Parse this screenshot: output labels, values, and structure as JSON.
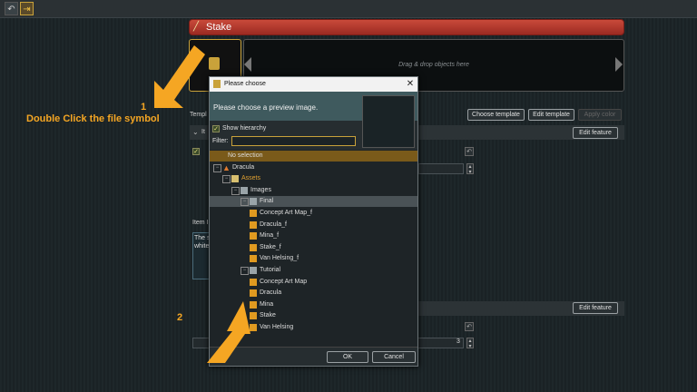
{
  "topbar": {
    "btn1_icon": "undo-icon",
    "btn2_icon": "export-icon"
  },
  "editor": {
    "title": "Stake",
    "drop_hint": "Drag & drop objects here",
    "template_label": "Templ",
    "buttons": {
      "choose_template": "Choose template",
      "edit_template": "Edit template",
      "apply_color": "Apply color",
      "edit_feature_1": "Edit feature",
      "edit_feature_2": "Edit feature"
    },
    "item_label": "Item I",
    "desc_text_1": "The s",
    "desc_text_2": "white",
    "section_label": "It",
    "number_value": "3"
  },
  "dialog": {
    "title": "Please choose",
    "prompt": "Please choose a preview image.",
    "show_hierarchy_label": "Show hierarchy",
    "show_hierarchy_checked": true,
    "filter_label": "Filter:",
    "filter_value": "",
    "tree": [
      {
        "label": "No selection",
        "depth": 0,
        "kind": "none",
        "state": "highlighted"
      },
      {
        "label": "Dracula",
        "depth": 0,
        "kind": "project",
        "expander": "⊟"
      },
      {
        "label": "Assets",
        "depth": 1,
        "kind": "folder",
        "expander": "⊟"
      },
      {
        "label": "Images",
        "depth": 2,
        "kind": "doc",
        "expander": "⊟"
      },
      {
        "label": "Final",
        "depth": 3,
        "kind": "doc",
        "expander": "⊟",
        "state": "selected"
      },
      {
        "label": "Concept Art Map_f",
        "depth": 4,
        "kind": "file"
      },
      {
        "label": "Dracula_f",
        "depth": 4,
        "kind": "file"
      },
      {
        "label": "Mina_f",
        "depth": 4,
        "kind": "file"
      },
      {
        "label": "Stake_f",
        "depth": 4,
        "kind": "file"
      },
      {
        "label": "Van Helsing_f",
        "depth": 4,
        "kind": "file"
      },
      {
        "label": "Tutorial",
        "depth": 3,
        "kind": "doc",
        "expander": "⊟"
      },
      {
        "label": "Concept Art Map",
        "depth": 4,
        "kind": "file"
      },
      {
        "label": "Dracula",
        "depth": 4,
        "kind": "file"
      },
      {
        "label": "Mina",
        "depth": 4,
        "kind": "file"
      },
      {
        "label": "Stake",
        "depth": 4,
        "kind": "file"
      },
      {
        "label": "Van Helsing",
        "depth": 4,
        "kind": "file"
      }
    ],
    "ok_label": "OK",
    "cancel_label": "Cancel"
  },
  "annotations": {
    "step1_number": "1",
    "step1_text": "Double Click the file symbol",
    "step2_number": "2",
    "color": "#f5a623"
  }
}
